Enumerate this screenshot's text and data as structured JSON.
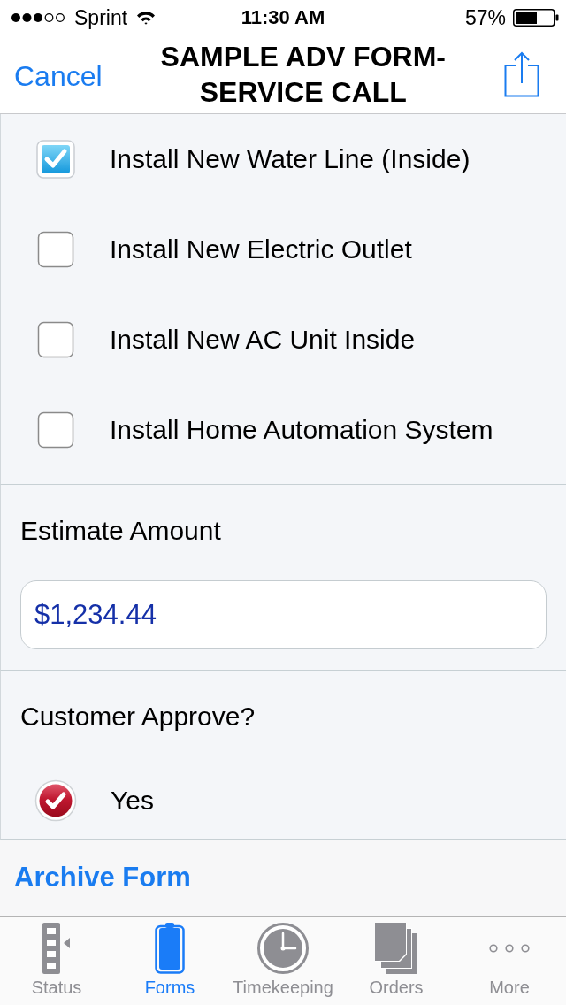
{
  "status_bar": {
    "carrier": "Sprint",
    "time": "11:30 AM",
    "battery": "57%"
  },
  "nav_bar": {
    "cancel": "Cancel",
    "title": "SAMPLE ADV FORM-SERVICE CALL"
  },
  "checklist": [
    {
      "label": "Install New Water Line (Inside)",
      "checked": true
    },
    {
      "label": "Install New Electric Outlet",
      "checked": false
    },
    {
      "label": "Install New AC Unit Inside",
      "checked": false
    },
    {
      "label": "Install Home Automation System",
      "checked": false
    }
  ],
  "estimate": {
    "label": "Estimate Amount",
    "value": "$1,234.44"
  },
  "approval": {
    "label": "Customer Approve?",
    "options": [
      {
        "label": "Yes",
        "selected": true
      }
    ]
  },
  "archive_button": "Archive Form",
  "tab_bar": [
    {
      "label": "Status",
      "selected": false
    },
    {
      "label": "Forms",
      "selected": true
    },
    {
      "label": "Timekeeping",
      "selected": false
    },
    {
      "label": "Orders",
      "selected": false
    },
    {
      "label": "More",
      "selected": false
    }
  ]
}
